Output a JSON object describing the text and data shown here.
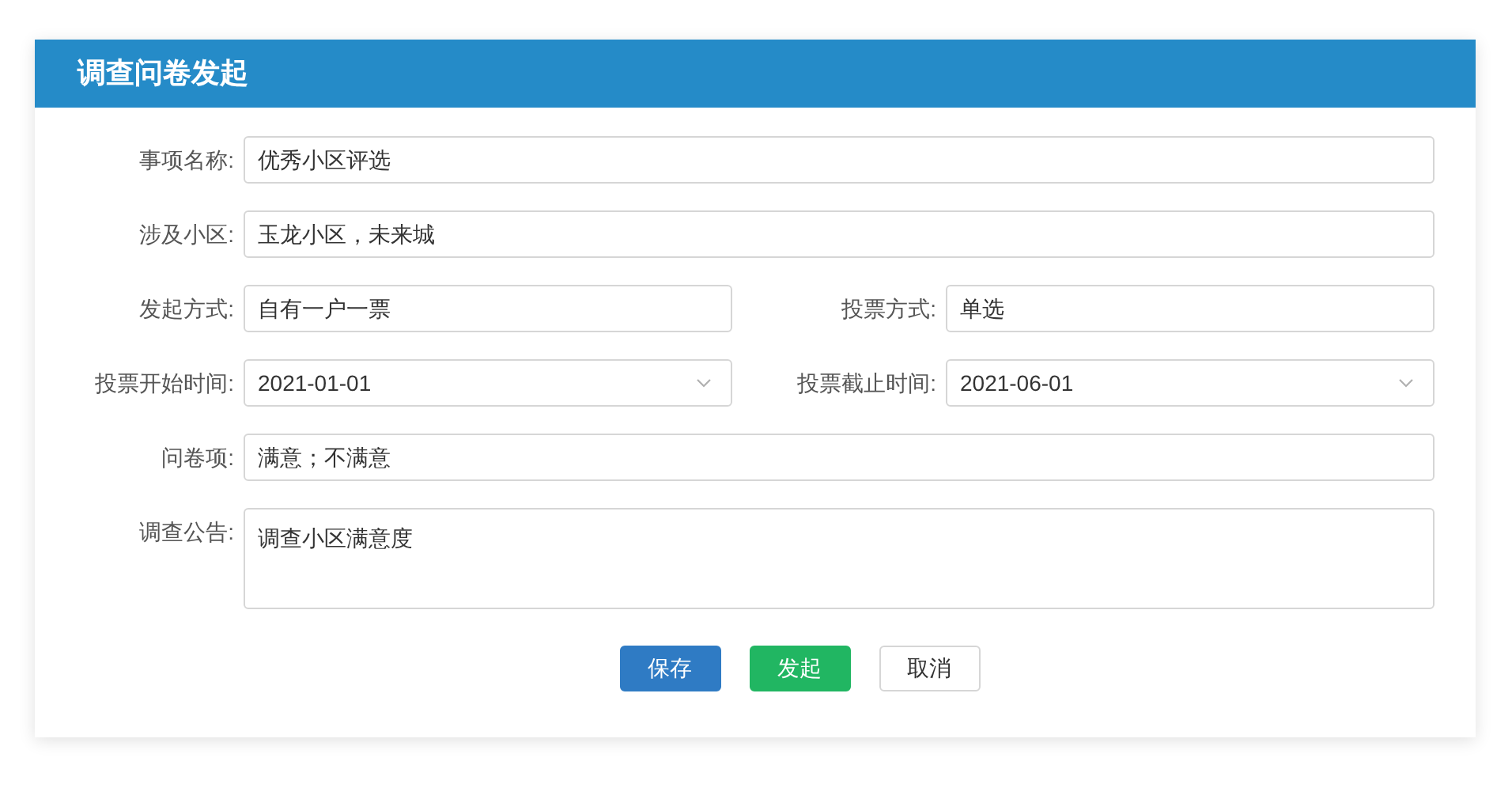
{
  "title": "调查问卷发起",
  "rows": [
    {
      "fields": [
        {
          "label": "事项名称:",
          "value": "优秀小区评选",
          "kind": "text"
        }
      ]
    },
    {
      "fields": [
        {
          "label": "涉及小区:",
          "value": "玉龙小区，未来城",
          "kind": "text"
        }
      ]
    },
    {
      "fields": [
        {
          "label": "发起方式:",
          "value": "自有一户一票",
          "kind": "text"
        },
        {
          "label": "投票方式:",
          "value": "单选",
          "kind": "text"
        }
      ]
    },
    {
      "fields": [
        {
          "label": "投票开始时间:",
          "value": "2021-01-01",
          "kind": "select"
        },
        {
          "label": "投票截止时间:",
          "value": "2021-06-01",
          "kind": "select"
        }
      ]
    },
    {
      "fields": [
        {
          "label": "问卷项:",
          "value": "满意；不满意",
          "kind": "text"
        }
      ]
    },
    {
      "fields": [
        {
          "label": "调查公告:",
          "value": "调查小区满意度",
          "kind": "textarea"
        }
      ]
    }
  ],
  "buttons": [
    {
      "label": "保存",
      "kind": "primary"
    },
    {
      "label": "发起",
      "kind": "success"
    },
    {
      "label": "取消",
      "kind": "default"
    }
  ]
}
